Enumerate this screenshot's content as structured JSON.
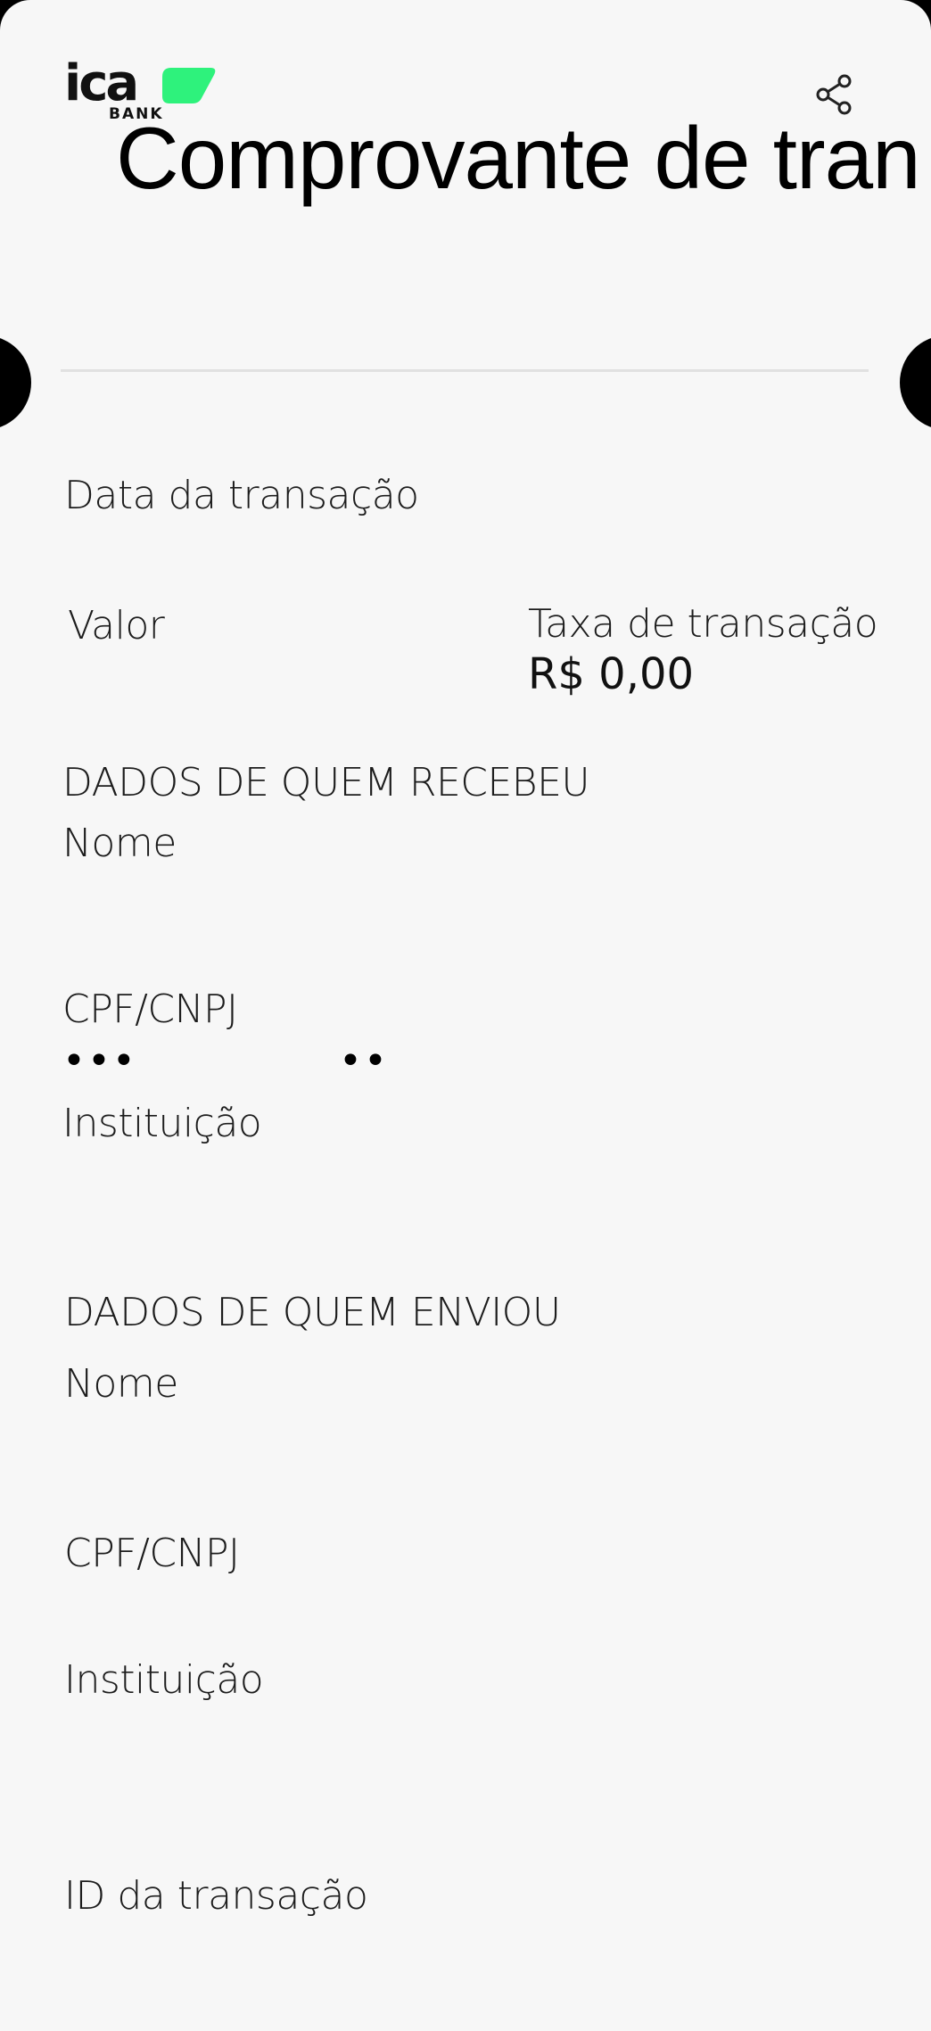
{
  "brand": {
    "logo_text": "ica",
    "logo_sub": "BANK",
    "accent_color": "#2ef27c"
  },
  "header": {
    "title": "Comprovante de tran",
    "share_icon": "share-icon"
  },
  "transaction": {
    "date_label": "Data da transação",
    "value_label": "Valor",
    "fee_label": "Taxa de transação",
    "fee_value": "R$ 0,00",
    "id_label": "ID da transação"
  },
  "receiver": {
    "section_title": "DADOS DE QUEM RECEBEU",
    "name_label": "Nome",
    "document_label": "CPF/CNPJ",
    "document_mask_start": "•••",
    "document_mask_end": "••",
    "institution_label": "Instituição"
  },
  "sender": {
    "section_title": "DADOS DE QUEM ENVIOU",
    "name_label": "Nome",
    "document_label": "CPF/CNPJ",
    "institution_label": "Instituição"
  }
}
